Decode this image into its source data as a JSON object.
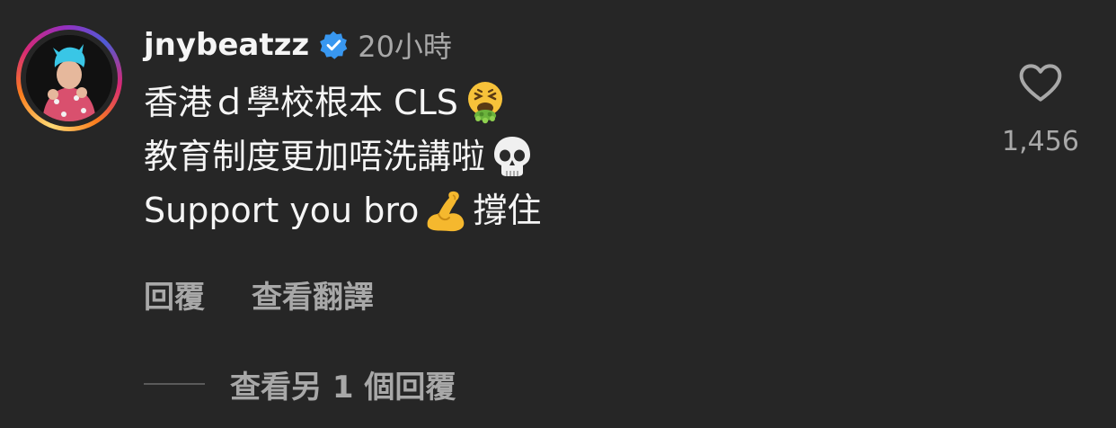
{
  "comment": {
    "username": "jnybeatzz",
    "verified_icon": "verified-badge-icon",
    "time": "20小時",
    "lines": [
      {
        "text": "香港ｄ學校根本 CLS",
        "emoji": "vomiting-face-emoji"
      },
      {
        "text": "教育制度更加唔洗講啦",
        "emoji": "skull-emoji"
      },
      {
        "text_before": "Support you bro",
        "emoji": "flexed-biceps-emoji",
        "text_after": "撐住"
      }
    ],
    "actions": {
      "reply": "回覆",
      "translate": "查看翻譯"
    },
    "view_replies": "查看另 1 個回覆",
    "like_icon": "heart-outline-icon",
    "like_count": "1,456"
  },
  "colors": {
    "background": "#262626",
    "primary_text": "#f5f5f5",
    "secondary_text": "#a8a8a8",
    "verified_blue": "#3897f0"
  }
}
